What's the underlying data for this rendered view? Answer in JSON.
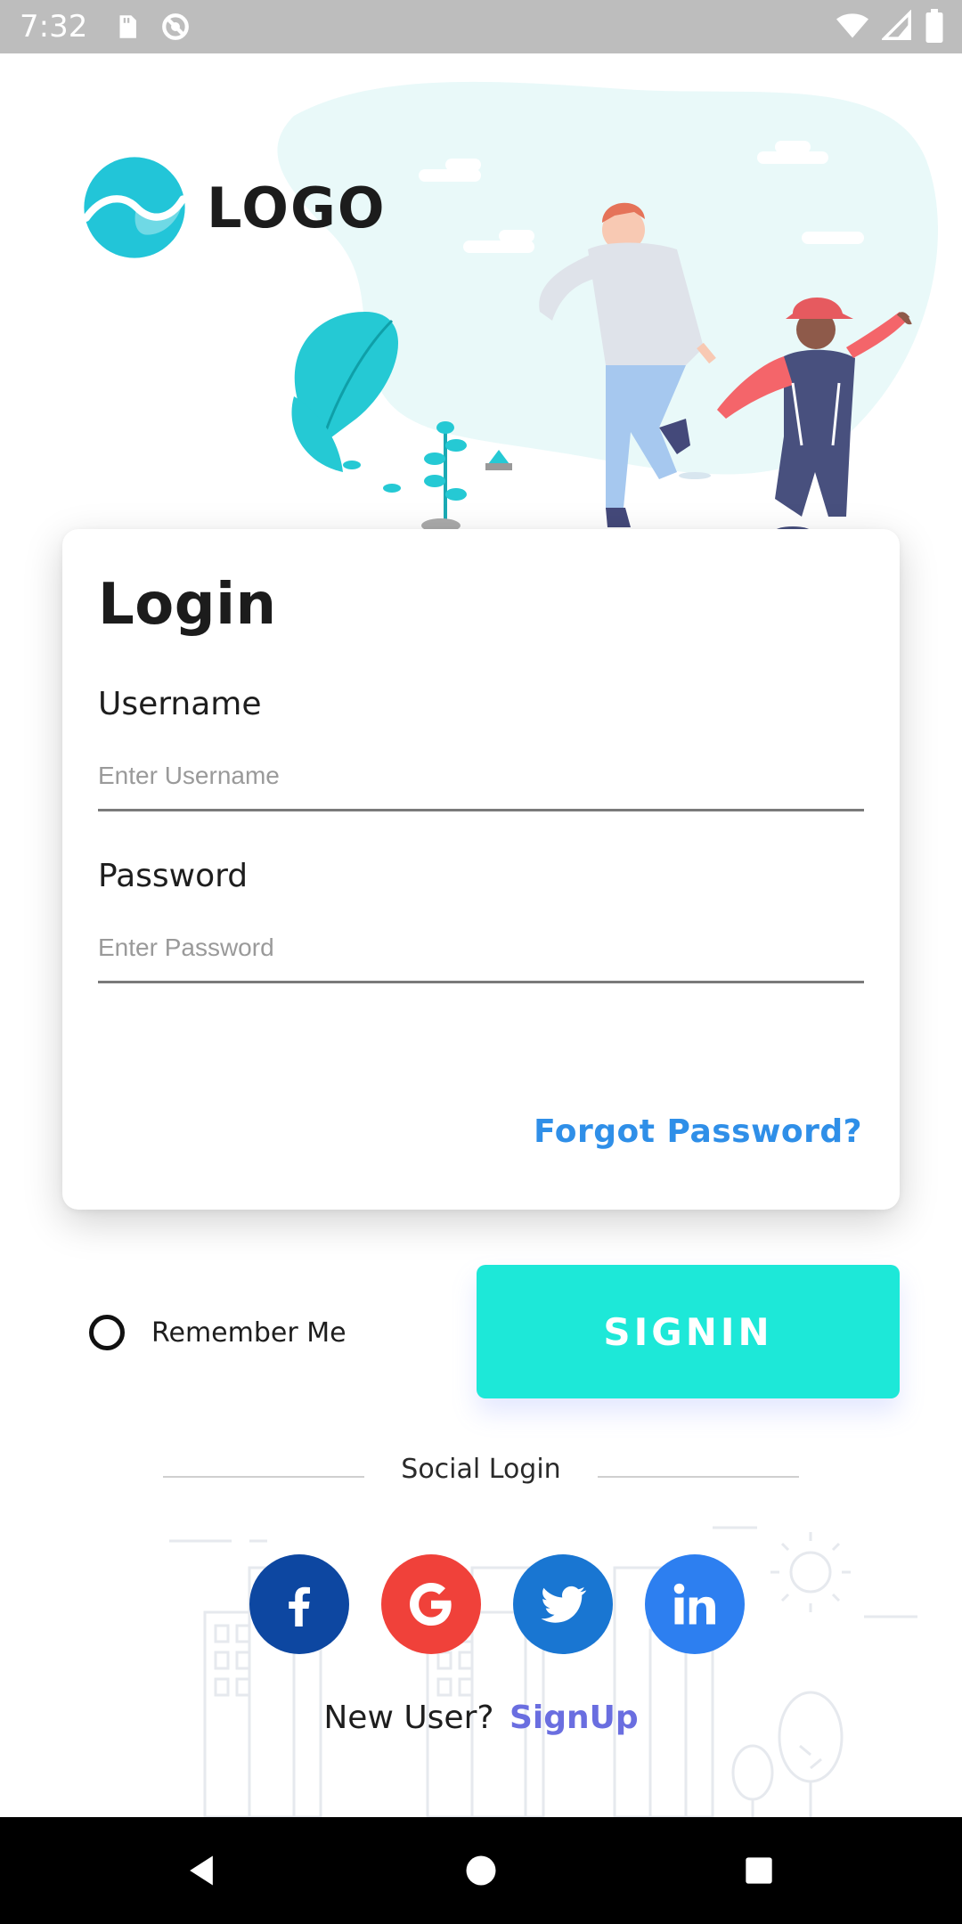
{
  "status_bar": {
    "time": "7:32",
    "left_icons": [
      "sd-card-icon",
      "no-disturb-icon"
    ],
    "right_icons": [
      "wifi-icon",
      "cell-signal-icon",
      "battery-icon"
    ]
  },
  "header": {
    "logo_text": "LOGO"
  },
  "login_card": {
    "title": "Login",
    "username": {
      "label": "Username",
      "placeholder": "Enter Username",
      "value": ""
    },
    "password": {
      "label": "Password",
      "placeholder": "Enter Password",
      "value": ""
    },
    "forgot_label": "Forgot Password?"
  },
  "remember": {
    "label": "Remember Me",
    "checked": false
  },
  "signin_label": "SIGNIN",
  "social": {
    "title": "Social Login",
    "providers": [
      "facebook",
      "google",
      "twitter",
      "linkedin"
    ]
  },
  "signup": {
    "prompt": "New User?",
    "link": "SignUp"
  },
  "colors": {
    "accent": "#1de8d8",
    "link": "#2f8fe8",
    "signup_link": "#6a6ee0",
    "facebook": "#0d47a1",
    "google": "#f0413a",
    "twitter": "#1976d2",
    "linkedin": "#2d7ff0"
  }
}
